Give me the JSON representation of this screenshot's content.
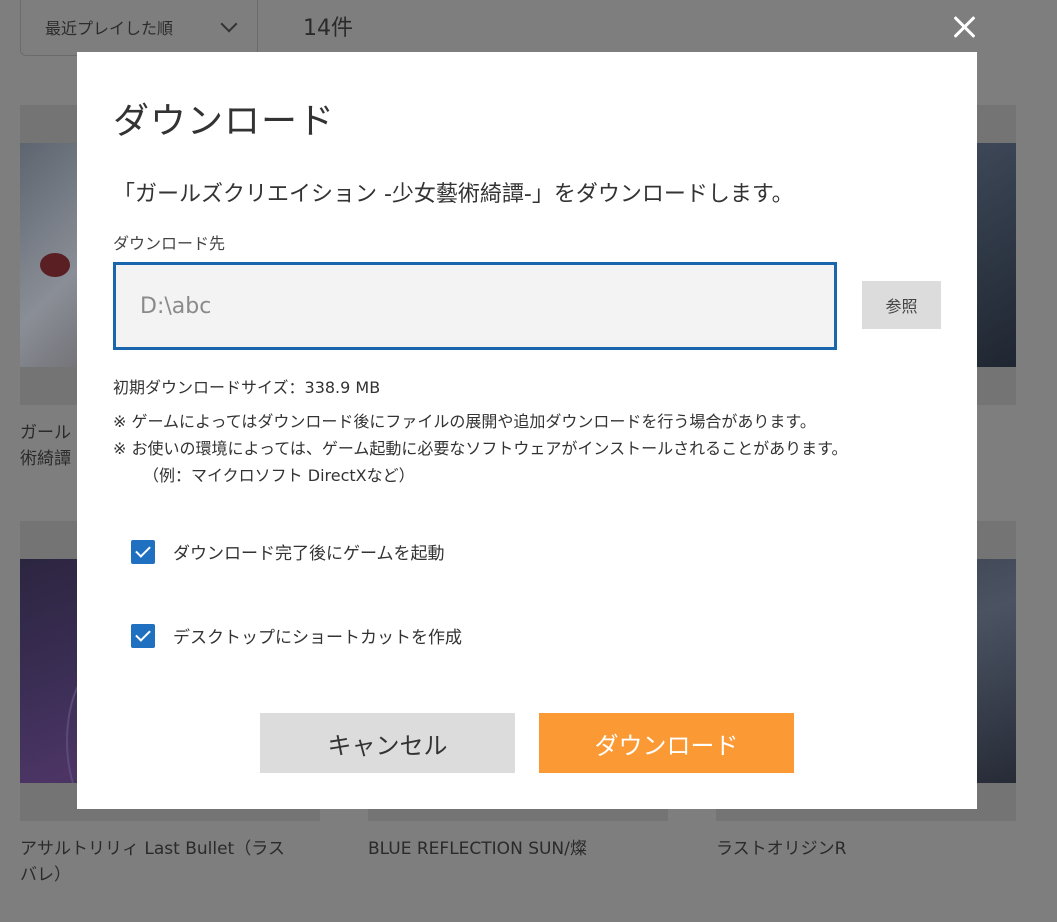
{
  "background": {
    "sort_label": "最近プレイした順",
    "count_label": "14件",
    "games": [
      {
        "title": "ガール術綺譚"
      },
      {
        "title": "アサルトリリィ Last Bullet（ラスバレ）"
      },
      {
        "title": "BLUE REFLECTION SUN/燦"
      },
      {
        "title": "ラストオリジンR"
      }
    ]
  },
  "dialog": {
    "title": "ダウンロード",
    "message": "「ガールズクリエイション -少女藝術綺譚-」をダウンロードします。",
    "destination_label": "ダウンロード先",
    "path_value": "D:\\abc",
    "browse_label": "参照",
    "size_line": "初期ダウンロードサイズ：338.9 MB",
    "notes": [
      "※ ゲームによってはダウンロード後にファイルの展開や追加ダウンロードを行う場合があります。",
      "※ お使いの環境によっては、ゲーム起動に必要なソフトウェアがインストールされることがあります。",
      "（例：マイクロソフト DirectXなど）"
    ],
    "options": [
      {
        "label": "ダウンロード完了後にゲームを起動",
        "checked": true
      },
      {
        "label": "デスクトップにショートカットを作成",
        "checked": true
      }
    ],
    "cancel_label": "キャンセル",
    "download_label": "ダウンロード"
  },
  "colors": {
    "accent_orange": "#fb9a35",
    "checkbox_blue": "#1f70c1",
    "input_border": "#1a66ad"
  }
}
